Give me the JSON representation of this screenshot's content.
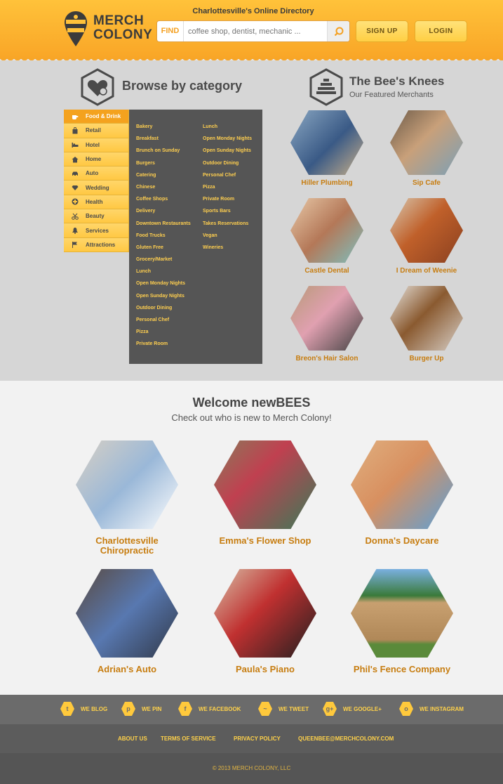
{
  "header": {
    "logo_line1": "MERCH",
    "logo_line2": "COLONY",
    "tagline": "Charlottesville's Online Directory",
    "search_label": "FIND",
    "search_placeholder": "coffee shop, dentist, mechanic ...",
    "signup_label": "SIGN UP",
    "login_label": "LOGIN"
  },
  "browse": {
    "title": "Browse by category",
    "categories": [
      {
        "label": "Food & Drink",
        "icon": "coffee-cup-icon"
      },
      {
        "label": "Retail",
        "icon": "bag-icon"
      },
      {
        "label": "Hotel",
        "icon": "bed-icon"
      },
      {
        "label": "Home",
        "icon": "house-icon"
      },
      {
        "label": "Auto",
        "icon": "car-icon"
      },
      {
        "label": "Wedding",
        "icon": "diamond-icon"
      },
      {
        "label": "Health",
        "icon": "cross-icon"
      },
      {
        "label": "Beauty",
        "icon": "scissors-icon"
      },
      {
        "label": "Services",
        "icon": "bell-icon"
      },
      {
        "label": "Attractions",
        "icon": "flag-icon"
      }
    ],
    "sub_col1": [
      "Bakery",
      "Breakfast",
      "Brunch on Sunday",
      "Burgers",
      "Catering",
      "Chinese",
      "Coffee Shops",
      "Delivery",
      "Downtown Restaurants",
      "Food Trucks",
      "Gluten Free",
      "Grocery/Market",
      "Lunch",
      "Open Monday Nights",
      "Open Sunday Nights",
      "Outdoor Dining",
      "Personal Chef",
      "Pizza",
      "Private Room"
    ],
    "sub_col2": [
      "Lunch",
      "Open Monday Nights",
      "Open Sunday Nights",
      "Outdoor Dining",
      "Personal Chef",
      "Pizza",
      "Private Room",
      "Sports Bars",
      "Takes Reservations",
      "Vegan",
      "Wineries"
    ]
  },
  "featured": {
    "title": "The Bee's Knees",
    "subtitle": "Our Featured Merchants",
    "items": [
      {
        "label": "Hiller Plumbing"
      },
      {
        "label": "Sip Cafe"
      },
      {
        "label": "Castle Dental"
      },
      {
        "label": "I Dream of Weenie"
      },
      {
        "label": "Breon's Hair Salon"
      },
      {
        "label": "Burger Up"
      }
    ]
  },
  "welcome": {
    "title": "Welcome newBEES",
    "subtitle": "Check out who is new to Merch Colony!",
    "items": [
      {
        "label": "Charlottesville Chiropractic"
      },
      {
        "label": "Emma's Flower Shop"
      },
      {
        "label": "Donna's Daycare"
      },
      {
        "label": "Adrian's Auto"
      },
      {
        "label": "Paula's Piano"
      },
      {
        "label": "Phil's Fence Company"
      }
    ]
  },
  "footer": {
    "social": [
      {
        "label": "WE BLOG",
        "glyph": "t"
      },
      {
        "label": "WE PIN",
        "glyph": "p"
      },
      {
        "label": "WE FACEBOOK",
        "glyph": "f"
      },
      {
        "label": "WE TWEET",
        "glyph": "~"
      },
      {
        "label": "WE GOOGLE+",
        "glyph": "g+"
      },
      {
        "label": "WE INSTAGRAM",
        "glyph": "o"
      }
    ],
    "links": [
      "ABOUT US",
      "TERMS OF SERVICE",
      "PRIVACY POLICY",
      "QUEENBEE@MERCHCOLONY.COM"
    ],
    "copyright": "© 2013 MERCH COLONY, LLC"
  },
  "colors": {
    "accent": "#f7a527",
    "label": "#c77d10",
    "panel": "#555555"
  }
}
